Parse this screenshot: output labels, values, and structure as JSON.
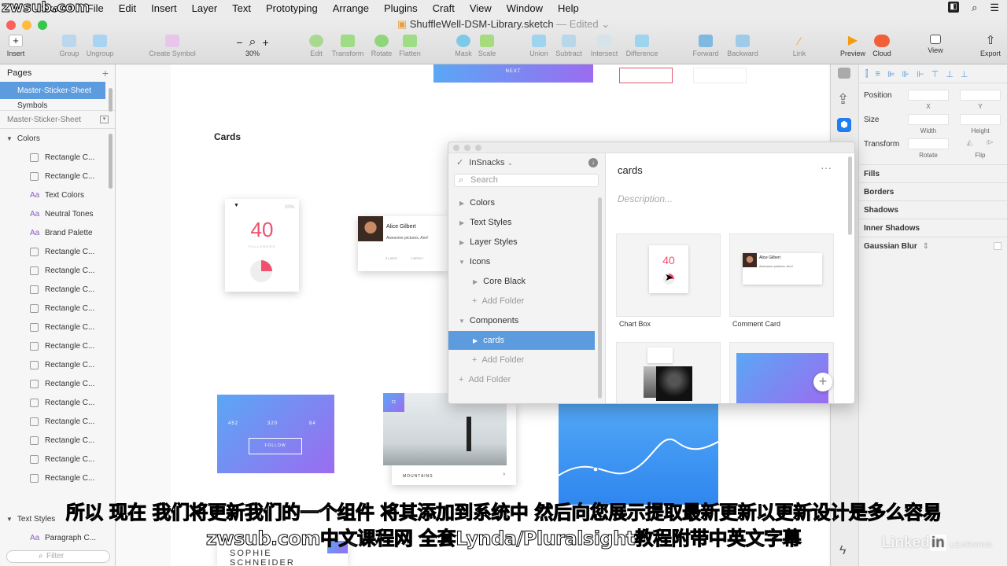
{
  "watermark_top": "zwsub.com",
  "menubar": {
    "items": [
      "Sketch",
      "File",
      "Edit",
      "Insert",
      "Layer",
      "Text",
      "Prototyping",
      "Arrange",
      "Plugins",
      "Craft",
      "View",
      "Window",
      "Help"
    ]
  },
  "window": {
    "doc_title": "ShuffleWell-DSM-Library.sketch",
    "edited": "— Edited ⌄"
  },
  "toolbar": {
    "insert": "Insert",
    "group": "Group",
    "ungroup": "Ungroup",
    "create_symbol": "Create Symbol",
    "zoom_minus": "−",
    "zoom_plus": "+",
    "zoom": "30%",
    "edit": "Edit",
    "transform": "Transform",
    "rotate": "Rotate",
    "flatten": "Flatten",
    "mask": "Mask",
    "scale": "Scale",
    "union": "Union",
    "subtract": "Subtract",
    "intersect": "Intersect",
    "difference": "Difference",
    "forward": "Forward",
    "backward": "Backward",
    "link": "Link",
    "preview": "Preview",
    "cloud": "Cloud",
    "view": "View",
    "export": "Export"
  },
  "sidebar": {
    "pages_label": "Pages",
    "pages": [
      "Master-Sticker-Sheet",
      "Symbols"
    ],
    "current_page": "Master-Sticker-Sheet",
    "colors_group": "Colors",
    "layers": [
      {
        "type": "rect",
        "label": "Rectangle C..."
      },
      {
        "type": "rect",
        "label": "Rectangle C..."
      },
      {
        "type": "text",
        "label": "Text Colors"
      },
      {
        "type": "text",
        "label": "Neutral Tones"
      },
      {
        "type": "text",
        "label": "Brand Palette"
      },
      {
        "type": "rect",
        "label": "Rectangle C..."
      },
      {
        "type": "rect",
        "label": "Rectangle C..."
      },
      {
        "type": "rect",
        "label": "Rectangle C..."
      },
      {
        "type": "rect",
        "label": "Rectangle C..."
      },
      {
        "type": "rect",
        "label": "Rectangle C..."
      },
      {
        "type": "rect",
        "label": "Rectangle C..."
      },
      {
        "type": "rect",
        "label": "Rectangle C..."
      },
      {
        "type": "rect",
        "label": "Rectangle C..."
      },
      {
        "type": "rect",
        "label": "Rectangle C..."
      },
      {
        "type": "rect",
        "label": "Rectangle C..."
      },
      {
        "type": "rect",
        "label": "Rectangle C..."
      },
      {
        "type": "rect",
        "label": "Rectangle C..."
      },
      {
        "type": "rect",
        "label": "Rectangle C..."
      }
    ],
    "text_styles_group": "Text Styles",
    "paragraph": "Paragraph C...",
    "filter": "Filter"
  },
  "canvas": {
    "cards_heading": "Cards",
    "next_label": "NEXT",
    "chart_card": {
      "value": "40",
      "caption": "FOLLOWERS",
      "pct": "20%"
    },
    "comment_card": {
      "name": "Alice Gilbert",
      "text": "Awesome pictures, Ann!",
      "likes": "3 LIKES",
      "reply": "1 REPLY"
    },
    "stats_card": {
      "stat1": "452",
      "stat2": "320",
      "stat3": "84",
      "follow": "FOLLOW"
    },
    "photo_card": {
      "badge": "21",
      "caption": "MOUNTAINS"
    },
    "profile_name": "SOPHIE SCHNEIDER"
  },
  "panel": {
    "library": "InSnacks",
    "search_placeholder": "Search",
    "tree": {
      "colors": "Colors",
      "text_styles": "Text Styles",
      "layer_styles": "Layer Styles",
      "icons": "Icons",
      "core_black": "Core Black",
      "add_folder": "Add Folder",
      "components": "Components",
      "cards": "cards"
    },
    "detail_title": "cards",
    "description_placeholder": "Description...",
    "thumbnails": [
      "Chart Box",
      "Comment Card"
    ],
    "thumb_chart_value": "40",
    "thumb_comment_name": "Alice Gilbert",
    "thumb_comment_text": "Awesome pictures, Ann!"
  },
  "inspector": {
    "position": "Position",
    "x": "X",
    "y": "Y",
    "size": "Size",
    "width": "Width",
    "height": "Height",
    "transform": "Transform",
    "rotate": "Rotate",
    "flip": "Flip",
    "fills": "Fills",
    "borders": "Borders",
    "shadows": "Shadows",
    "inner_shadows": "Inner Shadows",
    "gaussian_blur": "Gaussian Blur"
  },
  "subtitles": {
    "line1": "所以 现在 我们将更新我们的一个组件 将其添加到系统中 然后向您展示提取最新更新以更新设计是多么容易",
    "line2": "zwsub.com中文课程网 全套Lynda/Pluralsight教程附带中英文字幕"
  },
  "branding": {
    "linkedin": "Linked",
    "in": "in",
    "learning": "LEARNING"
  },
  "colors": {
    "accent": "#5b9bde",
    "gradient_start": "#5aa7f5",
    "gradient_end": "#9b6cf0",
    "pink": "#f0506e"
  }
}
